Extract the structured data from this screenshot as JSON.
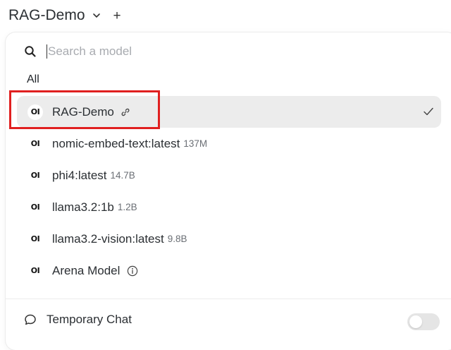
{
  "header": {
    "model_title": "RAG-Demo",
    "chevron_icon": "chevron-down-icon",
    "add_label": "+"
  },
  "search": {
    "placeholder": "Search a model",
    "value": ""
  },
  "filter": {
    "active_tab": "All"
  },
  "models": [
    {
      "icon_text": "OI",
      "name": "RAG-Demo",
      "size": "",
      "badge_icon": "link-icon",
      "selected": true
    },
    {
      "icon_text": "OI",
      "name": "nomic-embed-text:latest",
      "size": "137M"
    },
    {
      "icon_text": "OI",
      "name": "phi4:latest",
      "size": "14.7B"
    },
    {
      "icon_text": "OI",
      "name": "llama3.2:1b",
      "size": "1.2B"
    },
    {
      "icon_text": "OI",
      "name": "llama3.2-vision:latest",
      "size": "9.8B"
    },
    {
      "icon_text": "OI",
      "name": "Arena Model",
      "size": "",
      "badge_icon": "info-icon"
    }
  ],
  "footer": {
    "temporary_chat_label": "Temporary Chat",
    "temporary_chat_enabled": false
  },
  "colors": {
    "highlight": "#e02020",
    "selected_bg": "#ececec"
  }
}
